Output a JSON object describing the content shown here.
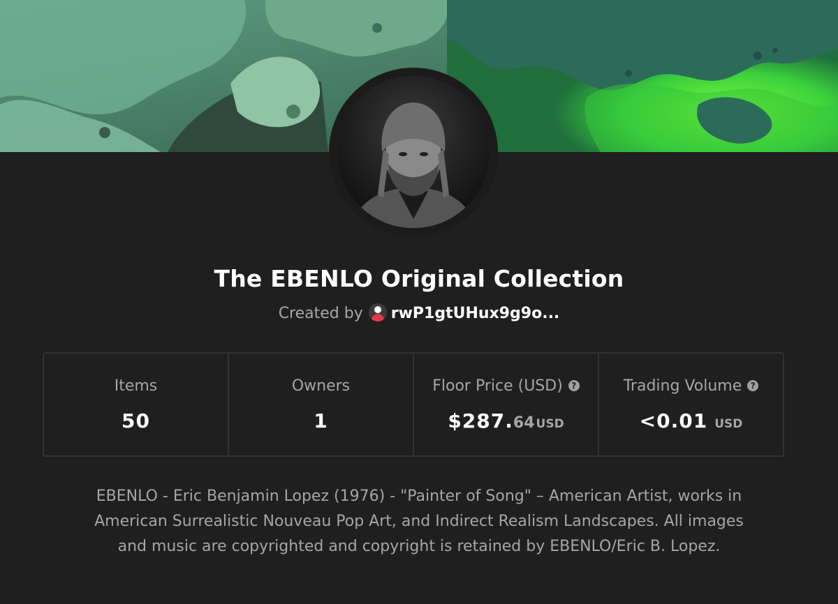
{
  "collection": {
    "title": "The EBENLO Original Collection",
    "created_by_label": "Created by",
    "creator_address": "rwP1gtUHux9g9o...",
    "description": "EBENLO - Eric Benjamin Lopez (1976) - \"Painter of Song\" – American Artist, works in American Surrealistic Nouveau Pop Art, and Indirect Realism Landscapes. All images and music are copyrighted and copyright is retained by EBENLO/Eric B. Lopez."
  },
  "stats": {
    "items": {
      "label": "Items",
      "value": "50"
    },
    "owners": {
      "label": "Owners",
      "value": "1"
    },
    "floor_price": {
      "label": "Floor Price (USD)",
      "value_int": "$287.",
      "value_dec": "64",
      "unit": "USD",
      "help": "?"
    },
    "trading_volume": {
      "label": "Trading Volume",
      "value": "<0.01",
      "unit": "USD",
      "help": "?"
    }
  },
  "colors": {
    "background": "#1f1f1f",
    "border": "#333333",
    "muted_text": "#a6a6a6",
    "creator_icon_accent": "#e03a4a",
    "banner_green": "#3f7a60"
  },
  "icons": {
    "creator_avatar": "user-avatar-icon",
    "help": "question-circle-icon"
  }
}
